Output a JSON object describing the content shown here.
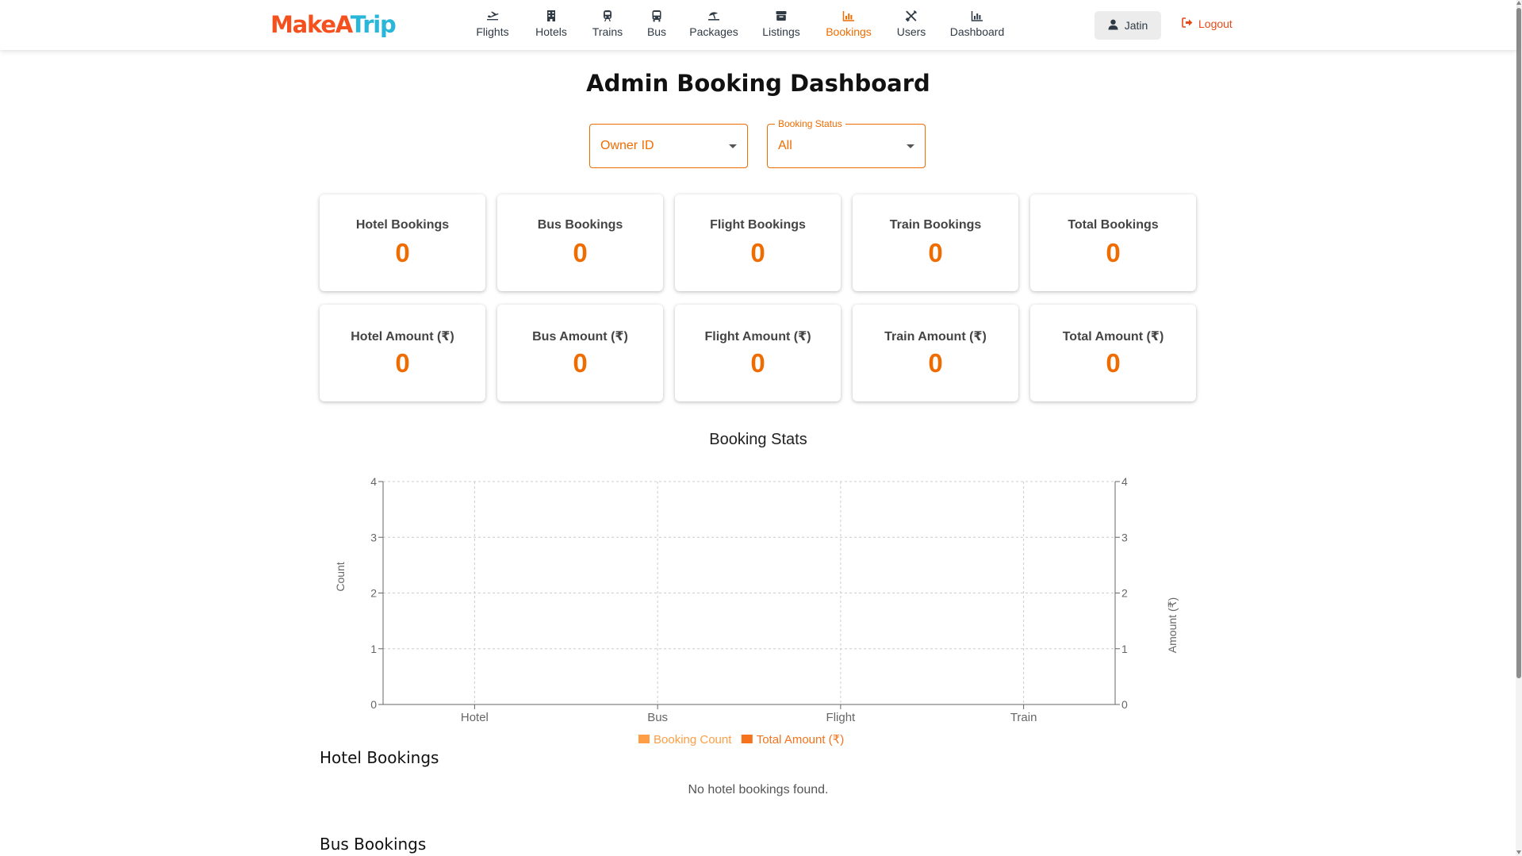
{
  "app": {
    "logo_part1": "MakeA",
    "logo_part2": "Trip",
    "brand_color": "#f4511e",
    "brand_color2": "#29b6d8",
    "accent_color": "#ef6c00"
  },
  "nav": {
    "items": [
      {
        "label": "Flights",
        "icon": "plane-icon"
      },
      {
        "label": "Hotels",
        "icon": "hotel-icon"
      },
      {
        "label": "Trains",
        "icon": "train-icon"
      },
      {
        "label": "Bus",
        "icon": "bus-icon"
      },
      {
        "label": "Packages",
        "icon": "umbrella-beach-icon"
      },
      {
        "label": "Listings",
        "icon": "list-box-icon"
      },
      {
        "label": "Bookings",
        "icon": "bar-chart-icon",
        "active": true
      },
      {
        "label": "Users",
        "icon": "tools-icon"
      },
      {
        "label": "Dashboard",
        "icon": "bar-chart-icon"
      }
    ],
    "user_name": "Jatin",
    "logout_label": "Logout"
  },
  "page": {
    "title": "Admin Booking Dashboard"
  },
  "filters": {
    "owner_placeholder": "Owner ID",
    "status_label": "Booking Status",
    "status_value": "All"
  },
  "cards": {
    "bookings": [
      {
        "label": "Hotel Bookings",
        "value": "0"
      },
      {
        "label": "Bus Bookings",
        "value": "0"
      },
      {
        "label": "Flight Bookings",
        "value": "0"
      },
      {
        "label": "Train Bookings",
        "value": "0"
      },
      {
        "label": "Total Bookings",
        "value": "0"
      }
    ],
    "amounts": [
      {
        "label": "Hotel Amount (₹)",
        "value": "0"
      },
      {
        "label": "Bus Amount (₹)",
        "value": "0"
      },
      {
        "label": "Flight Amount (₹)",
        "value": "0"
      },
      {
        "label": "Train Amount (₹)",
        "value": "0"
      },
      {
        "label": "Total Amount (₹)",
        "value": "0"
      }
    ]
  },
  "chart_data": {
    "type": "bar",
    "title": "Booking Stats",
    "categories": [
      "Hotel",
      "Bus",
      "Flight",
      "Train"
    ],
    "series": [
      {
        "name": "Booking Count",
        "values": [
          0,
          0,
          0,
          0
        ],
        "color": "#ff9e45"
      },
      {
        "name": "Total Amount (₹)",
        "values": [
          0,
          0,
          0,
          0
        ],
        "color": "#f4731c"
      }
    ],
    "ylabel": "Count",
    "y2label": "Amount (₹)",
    "ylim": [
      0,
      4
    ],
    "y2lim": [
      0,
      4
    ],
    "yticks": [
      "0",
      "1",
      "2",
      "3",
      "4"
    ],
    "y2ticks": [
      "0",
      "1",
      "2",
      "3",
      "4"
    ],
    "grid": true,
    "legend": "bottom-center"
  },
  "sections": {
    "hotel_title": "Hotel Bookings",
    "hotel_empty": "No hotel bookings found.",
    "bus_title": "Bus Bookings"
  }
}
